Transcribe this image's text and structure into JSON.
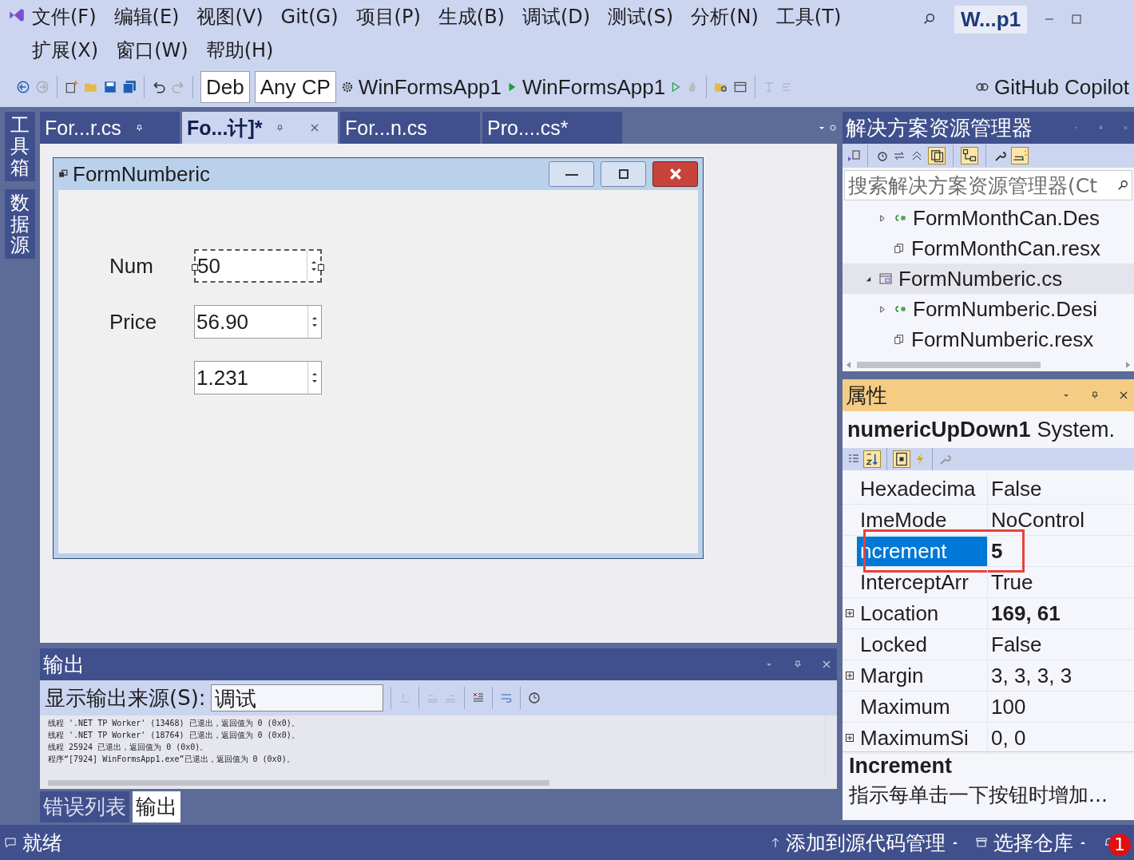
{
  "menu": [
    "文件(F)",
    "编辑(E)",
    "视图(V)",
    "Git(G)",
    "项目(P)",
    "生成(B)",
    "调试(D)",
    "测试(S)",
    "分析(N)",
    "工具(T)",
    "扩展(X)",
    "窗口(W)",
    "帮助(H)"
  ],
  "title_badge": "W...p1",
  "toolbar": {
    "configuration": "Deb",
    "platform": "Any CP",
    "startup_project": "WinFormsApp1",
    "run_target": "WinFormsApp1",
    "copilot": "GitHub Copilot"
  },
  "left_strip": [
    "工具箱",
    "数据源"
  ],
  "editor_tabs": [
    {
      "label": "For...r.cs",
      "selected": false,
      "pinned": true
    },
    {
      "label": "Fo...计]*",
      "selected": true,
      "pinned": true
    },
    {
      "label": "For...n.cs",
      "selected": false,
      "pinned": false
    },
    {
      "label": "Pro....cs*",
      "selected": false,
      "pinned": false
    }
  ],
  "form": {
    "title": "FormNumberic",
    "fields": [
      {
        "label": "Num",
        "value": "50",
        "selected": true
      },
      {
        "label": "Price",
        "value": "56.90",
        "selected": false
      },
      {
        "value": "1.231",
        "selected": false
      }
    ]
  },
  "output": {
    "title": "输出",
    "source_label": "显示输出来源(S):",
    "source": "调试",
    "lines": [
      "线程 '.NET TP Worker' (13468) 已退出，返回值为 0 (0x0)。",
      "线程 '.NET TP Worker' (18764) 已退出，返回值为 0 (0x0)。",
      "线程 25924 已退出，返回值为 0 (0x0)。",
      "程序“[7924] WinFormsApp1.exe”已退出，返回值为 0 (0x0)。"
    ]
  },
  "bottom_tabs": [
    {
      "label": "错误列表",
      "selected": false
    },
    {
      "label": "输出",
      "selected": true
    }
  ],
  "solution_explorer": {
    "title": "解决方案资源管理器",
    "search_placeholder": "搜索解决方案资源管理器(Ct",
    "tree": [
      {
        "children": [
          {
            "label": "FormMonthCan.Des",
            "kind": "csharp",
            "expanded": false,
            "selected": false
          },
          {
            "label": "FormMonthCan.resx",
            "kind": "resource",
            "selected": false
          }
        ]
      },
      {
        "label": "FormNumberic.cs",
        "kind": "form",
        "expanded": true,
        "selected": true,
        "children": [
          {
            "label": "FormNumberic.Desi",
            "kind": "csharp",
            "expanded": false,
            "selected": false
          },
          {
            "label": "FormNumberic.resx",
            "kind": "resource",
            "selected": false
          }
        ]
      }
    ]
  },
  "properties": {
    "title": "属性",
    "object": "numericUpDown1",
    "type": "System.",
    "rows": [
      {
        "name": "Hexadecima",
        "value": "False",
        "expandable": false,
        "bold": false,
        "selected": false
      },
      {
        "name": "ImeMode",
        "value": "NoControl",
        "expandable": false,
        "bold": false,
        "selected": false
      },
      {
        "name": "ncrement",
        "value": "5",
        "expandable": false,
        "bold": true,
        "selected": true
      },
      {
        "name": "InterceptArr",
        "value": "True",
        "expandable": false,
        "bold": false,
        "selected": false
      },
      {
        "name": "Location",
        "value": "169, 61",
        "expandable": true,
        "bold": true,
        "selected": false
      },
      {
        "name": "Locked",
        "value": "False",
        "expandable": false,
        "bold": false,
        "selected": false
      },
      {
        "name": "Margin",
        "value": "3, 3, 3, 3",
        "expandable": true,
        "bold": false,
        "selected": false
      },
      {
        "name": "Maximum",
        "value": "100",
        "expandable": false,
        "bold": false,
        "selected": false
      },
      {
        "name": "MaximumSi",
        "value": "0, 0",
        "expandable": true,
        "bold": false,
        "selected": false
      }
    ],
    "description_title": "Increment",
    "description": "指示每单击一下按钮时增加..."
  },
  "status": {
    "ready": "就绪",
    "source_control": "添加到源代码管理",
    "repository": "选择仓库",
    "notifications": "1"
  }
}
